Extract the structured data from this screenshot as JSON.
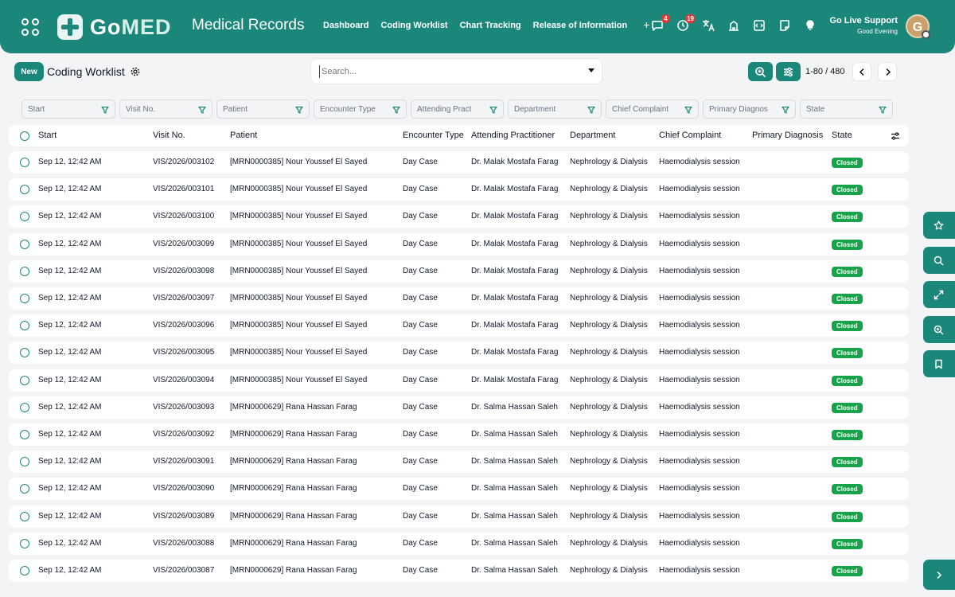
{
  "header": {
    "logo_text_a": "Go",
    "logo_text_b": "MED",
    "app_title": "Medical Records",
    "nav": [
      "Dashboard",
      "Coding Worklist",
      "Chart Tracking",
      "Release of Information"
    ],
    "add_label": "+",
    "messages_count": "4",
    "notifications_count": "19",
    "support_title": "Go Live Support",
    "support_greeting": "Good Evening",
    "avatar_initial": "G"
  },
  "toolbar": {
    "new_label": "New",
    "title": "Coding Worklist",
    "search_placeholder": "Search...",
    "pager": "1-80 / 480"
  },
  "filters": [
    "Start",
    "Visit No.",
    "Patient",
    "Encounter Type",
    "Attending Pract",
    "Department",
    "Chief Complaint",
    "Primary Diagnos",
    "State"
  ],
  "columns": [
    "Start",
    "Visit No.",
    "Patient",
    "Encounter Type",
    "Attending Practitioner",
    "Department",
    "Chief Complaint",
    "Primary Diagnosis",
    "State"
  ],
  "rows": [
    {
      "start": "Sep 12, 12:42 AM",
      "visit": "VIS/2026/003102",
      "patient": "[MRN0000385] Nour Youssef El Sayed",
      "type": "Day Case",
      "doctor": "Dr. Malak Mostafa Farag",
      "dept": "Nephrology & Dialysis",
      "complaint": "Haemodialysis session",
      "diagnosis": "",
      "state": "Closed"
    },
    {
      "start": "Sep 12, 12:42 AM",
      "visit": "VIS/2026/003101",
      "patient": "[MRN0000385] Nour Youssef El Sayed",
      "type": "Day Case",
      "doctor": "Dr. Malak Mostafa Farag",
      "dept": "Nephrology & Dialysis",
      "complaint": "Haemodialysis session",
      "diagnosis": "",
      "state": "Closed"
    },
    {
      "start": "Sep 12, 12:42 AM",
      "visit": "VIS/2026/003100",
      "patient": "[MRN0000385] Nour Youssef El Sayed",
      "type": "Day Case",
      "doctor": "Dr. Malak Mostafa Farag",
      "dept": "Nephrology & Dialysis",
      "complaint": "Haemodialysis session",
      "diagnosis": "",
      "state": "Closed"
    },
    {
      "start": "Sep 12, 12:42 AM",
      "visit": "VIS/2026/003099",
      "patient": "[MRN0000385] Nour Youssef El Sayed",
      "type": "Day Case",
      "doctor": "Dr. Malak Mostafa Farag",
      "dept": "Nephrology & Dialysis",
      "complaint": "Haemodialysis session",
      "diagnosis": "",
      "state": "Closed"
    },
    {
      "start": "Sep 12, 12:42 AM",
      "visit": "VIS/2026/003098",
      "patient": "[MRN0000385] Nour Youssef El Sayed",
      "type": "Day Case",
      "doctor": "Dr. Malak Mostafa Farag",
      "dept": "Nephrology & Dialysis",
      "complaint": "Haemodialysis session",
      "diagnosis": "",
      "state": "Closed"
    },
    {
      "start": "Sep 12, 12:42 AM",
      "visit": "VIS/2026/003097",
      "patient": "[MRN0000385] Nour Youssef El Sayed",
      "type": "Day Case",
      "doctor": "Dr. Malak Mostafa Farag",
      "dept": "Nephrology & Dialysis",
      "complaint": "Haemodialysis session",
      "diagnosis": "",
      "state": "Closed"
    },
    {
      "start": "Sep 12, 12:42 AM",
      "visit": "VIS/2026/003096",
      "patient": "[MRN0000385] Nour Youssef El Sayed",
      "type": "Day Case",
      "doctor": "Dr. Malak Mostafa Farag",
      "dept": "Nephrology & Dialysis",
      "complaint": "Haemodialysis session",
      "diagnosis": "",
      "state": "Closed"
    },
    {
      "start": "Sep 12, 12:42 AM",
      "visit": "VIS/2026/003095",
      "patient": "[MRN0000385] Nour Youssef El Sayed",
      "type": "Day Case",
      "doctor": "Dr. Malak Mostafa Farag",
      "dept": "Nephrology & Dialysis",
      "complaint": "Haemodialysis session",
      "diagnosis": "",
      "state": "Closed"
    },
    {
      "start": "Sep 12, 12:42 AM",
      "visit": "VIS/2026/003094",
      "patient": "[MRN0000385] Nour Youssef El Sayed",
      "type": "Day Case",
      "doctor": "Dr. Malak Mostafa Farag",
      "dept": "Nephrology & Dialysis",
      "complaint": "Haemodialysis session",
      "diagnosis": "",
      "state": "Closed"
    },
    {
      "start": "Sep 12, 12:42 AM",
      "visit": "VIS/2026/003093",
      "patient": "[MRN0000629] Rana Hassan Farag",
      "type": "Day Case",
      "doctor": "Dr. Salma Hassan Saleh",
      "dept": "Nephrology & Dialysis",
      "complaint": "Haemodialysis session",
      "diagnosis": "",
      "state": "Closed"
    },
    {
      "start": "Sep 12, 12:42 AM",
      "visit": "VIS/2026/003092",
      "patient": "[MRN0000629] Rana Hassan Farag",
      "type": "Day Case",
      "doctor": "Dr. Salma Hassan Saleh",
      "dept": "Nephrology & Dialysis",
      "complaint": "Haemodialysis session",
      "diagnosis": "",
      "state": "Closed"
    },
    {
      "start": "Sep 12, 12:42 AM",
      "visit": "VIS/2026/003091",
      "patient": "[MRN0000629] Rana Hassan Farag",
      "type": "Day Case",
      "doctor": "Dr. Salma Hassan Saleh",
      "dept": "Nephrology & Dialysis",
      "complaint": "Haemodialysis session",
      "diagnosis": "",
      "state": "Closed"
    },
    {
      "start": "Sep 12, 12:42 AM",
      "visit": "VIS/2026/003090",
      "patient": "[MRN0000629] Rana Hassan Farag",
      "type": "Day Case",
      "doctor": "Dr. Salma Hassan Saleh",
      "dept": "Nephrology & Dialysis",
      "complaint": "Haemodialysis session",
      "diagnosis": "",
      "state": "Closed"
    },
    {
      "start": "Sep 12, 12:42 AM",
      "visit": "VIS/2026/003089",
      "patient": "[MRN0000629] Rana Hassan Farag",
      "type": "Day Case",
      "doctor": "Dr. Salma Hassan Saleh",
      "dept": "Nephrology & Dialysis",
      "complaint": "Haemodialysis session",
      "diagnosis": "",
      "state": "Closed"
    },
    {
      "start": "Sep 12, 12:42 AM",
      "visit": "VIS/2026/003088",
      "patient": "[MRN0000629] Rana Hassan Farag",
      "type": "Day Case",
      "doctor": "Dr. Salma Hassan Saleh",
      "dept": "Nephrology & Dialysis",
      "complaint": "Haemodialysis session",
      "diagnosis": "",
      "state": "Closed"
    },
    {
      "start": "Sep 12, 12:42 AM",
      "visit": "VIS/2026/003087",
      "patient": "[MRN0000629] Rana Hassan Farag",
      "type": "Day Case",
      "doctor": "Dr. Salma Hassan Saleh",
      "dept": "Nephrology & Dialysis",
      "complaint": "Haemodialysis session",
      "diagnosis": "",
      "state": "Closed"
    }
  ],
  "icons": {
    "apps": "apps-grid-icon",
    "messages": "chat-bubble-icon",
    "notifications": "clock-alert-icon",
    "translate": "translate-icon",
    "building": "building-icon",
    "code": "code-window-icon",
    "note": "note-icon",
    "tip": "lightbulb-icon",
    "rail": [
      "star-icon",
      "search-icon",
      "expand-icon",
      "zoom-icon",
      "bookmark-icon",
      "chevron-right-icon"
    ]
  },
  "colors": {
    "brand": "#1b877a",
    "status_closed": "#16a34a"
  }
}
